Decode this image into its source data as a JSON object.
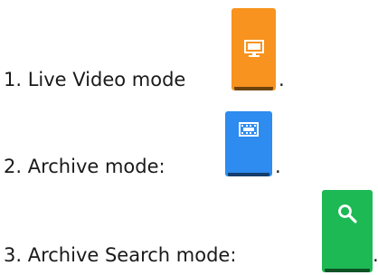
{
  "modes": [
    {
      "label": "1. Live Video mode",
      "trailing": ".",
      "icon": "monitor-icon",
      "color": "#F7931E"
    },
    {
      "label": "2. Archive mode:",
      "trailing": ".",
      "icon": "video-tape-icon",
      "color": "#2E8BEF"
    },
    {
      "label": "3. Archive Search mode:",
      "trailing": ".",
      "icon": "search-icon",
      "color": "#1DB954"
    }
  ]
}
